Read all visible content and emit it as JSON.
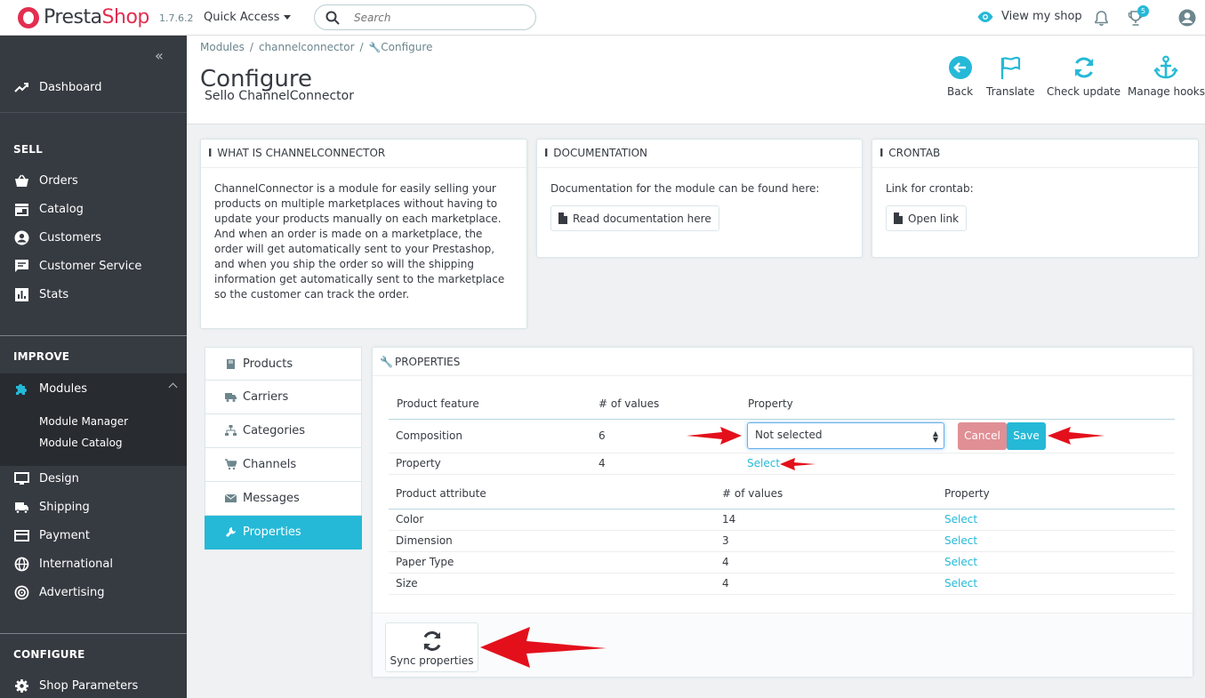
{
  "app": {
    "brand_presta": "Presta",
    "brand_shop": "Shop",
    "version": "1.7.6.2"
  },
  "topbar": {
    "quick_access": "Quick Access",
    "search_placeholder": "Search",
    "view_shop": "View my shop",
    "notification_count": "5"
  },
  "sidebar": {
    "dashboard": "Dashboard",
    "sell_title": "SELL",
    "sell_items": [
      "Orders",
      "Catalog",
      "Customers",
      "Customer Service",
      "Stats"
    ],
    "improve_title": "IMPROVE",
    "modules": "Modules",
    "modules_sub": [
      "Module Manager",
      "Module Catalog"
    ],
    "improve_items": [
      "Design",
      "Shipping",
      "Payment",
      "International",
      "Advertising"
    ],
    "configure_title": "CONFIGURE",
    "configure_items": [
      "Shop Parameters"
    ]
  },
  "breadcrumb": {
    "items": [
      "Modules",
      "channelconnector",
      "Configure"
    ]
  },
  "header": {
    "title": "Configure",
    "subtitle": "Sello ChannelConnector",
    "toolbar": [
      "Back",
      "Translate",
      "Check update",
      "Manage hooks"
    ]
  },
  "panels": {
    "what_title": "WHAT IS CHANNELCONNECTOR",
    "what_body": "ChannelConnector is a module for easily selling your products on multiple marketplaces without having to update your products manually on each marketplace. And when an order is made on a marketplace, the order will get automatically sent to your Prestashop, and when you ship the order so will the shipping information get automatically sent to the marketplace so the customer can track the order.",
    "doc_title": "DOCUMENTATION",
    "doc_body": "Documentation for the module can be found here:",
    "doc_button": "Read documentation here",
    "cron_title": "CRONTAB",
    "cron_body": "Link for crontab:",
    "cron_button": "Open link"
  },
  "tabs": [
    "Products",
    "Carriers",
    "Categories",
    "Channels",
    "Messages",
    "Properties"
  ],
  "properties": {
    "title": "PROPERTIES",
    "feature_headers": [
      "Product feature",
      "# of values",
      "Property"
    ],
    "features": [
      {
        "name": "Composition",
        "count": "6",
        "property": "Not selected"
      },
      {
        "name": "Property",
        "count": "4",
        "property": "Select"
      }
    ],
    "attribute_headers": [
      "Product attribute",
      "# of values",
      "Property"
    ],
    "attributes": [
      {
        "name": "Color",
        "count": "14",
        "property": "Select"
      },
      {
        "name": "Dimension",
        "count": "3",
        "property": "Select"
      },
      {
        "name": "Paper Type",
        "count": "4",
        "property": "Select"
      },
      {
        "name": "Size",
        "count": "4",
        "property": "Select"
      }
    ],
    "cancel": "Cancel",
    "save": "Save",
    "sync": "Sync properties"
  },
  "colors": {
    "accent": "#25b9d7",
    "sidebar": "#363a41",
    "brand": "#e22e51",
    "arrow": "#e3101c"
  }
}
